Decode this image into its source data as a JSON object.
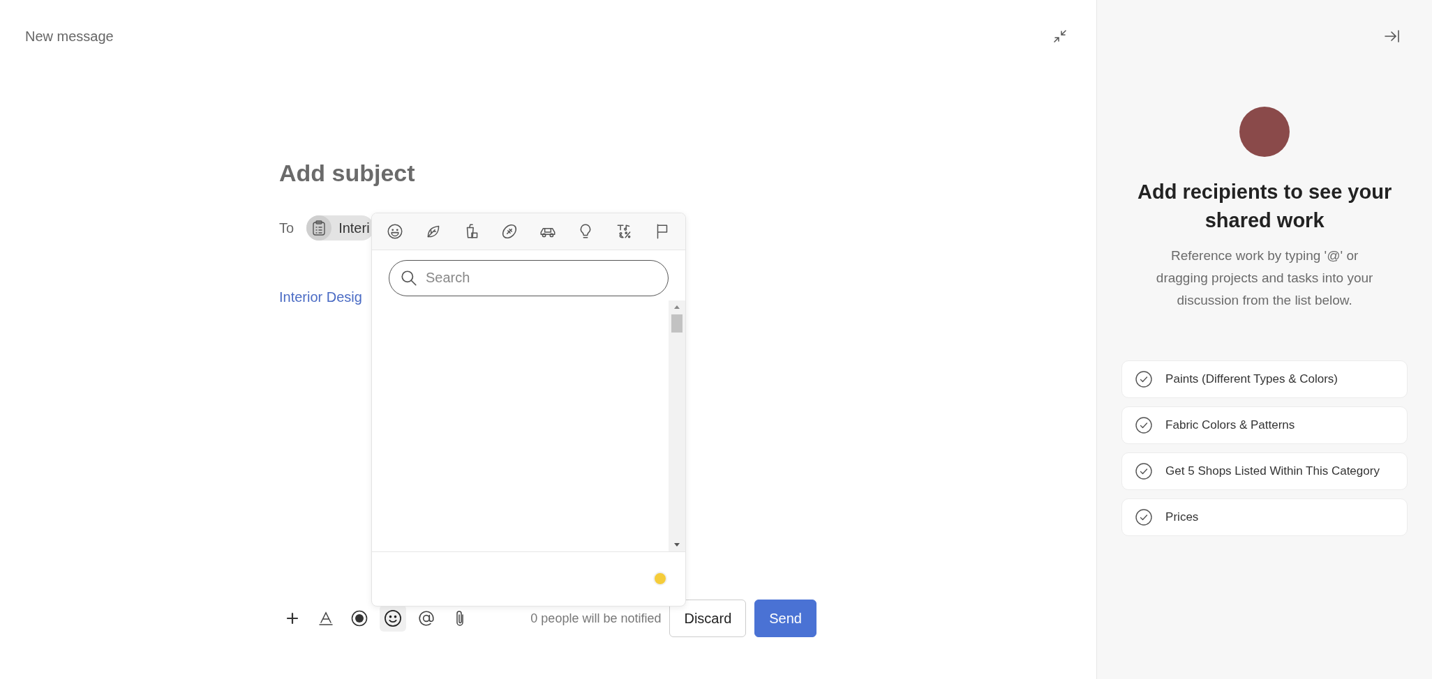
{
  "header": {
    "title": "New message"
  },
  "compose": {
    "subject_placeholder": "Add subject",
    "to_label": "To",
    "recipient_chip": "Interi",
    "link": "Interior Desig"
  },
  "emoji_picker": {
    "search_placeholder": "Search"
  },
  "toolbar": {
    "notice": "0 people will be notified",
    "buttons": [
      {
        "label": "Discard",
        "kind": "secondary"
      },
      {
        "label": "Send",
        "kind": "primary"
      }
    ]
  },
  "side_panel": {
    "title": "Add recipients to see your shared work",
    "description": "Reference work by typing '@' or dragging projects and tasks into your discussion from the list below.",
    "items": [
      {
        "label": "Paints (Different Types & Colors)"
      },
      {
        "label": "Fabric Colors & Patterns"
      },
      {
        "label": "Get 5 Shops Listed Within This Category"
      },
      {
        "label": "Prices"
      }
    ]
  }
}
